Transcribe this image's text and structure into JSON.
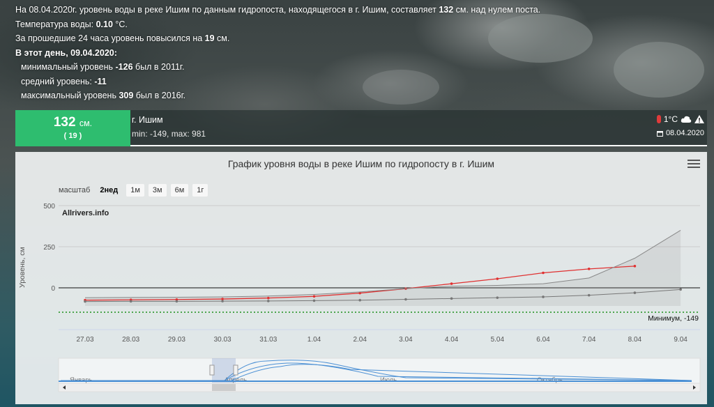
{
  "info": {
    "line1_pre": "На 08.04.2020г. уровень воды в реке Ишим по данным гидропоста, находящегося в г. Ишим, составляет ",
    "line1_value": "132",
    "line1_post": " см. над нулем поста.",
    "temp_pre": "Температура воды: ",
    "temp_value": "0.10",
    "temp_post": " °C.",
    "change_pre": "За прошедшие 24 часа уровень повысился на ",
    "change_value": "19",
    "change_post": " см.",
    "day_heading": "В этот день, 09.04.2020:",
    "min_pre": "минимальный уровень ",
    "min_value": "-126",
    "min_post": " был в 2011г.",
    "avg_pre": "средний уровень: ",
    "avg_value": "-11",
    "max_pre": "максимальный уровень ",
    "max_value": "309",
    "max_post": " был в 2016г."
  },
  "status": {
    "level": "132",
    "unit": "см.",
    "delta": "( 19 )",
    "station": "г. Ишим",
    "minmax": "min: -149, max: 981",
    "temperature": "1°C",
    "date": "08.04.2020",
    "accent": "#2ebd6f"
  },
  "chart": {
    "title": "График уровня воды в реке Ишим по гидропосту в г. Ишим",
    "zoom_label": "масштаб",
    "zoom_buttons": [
      "2нед",
      "1м",
      "3м",
      "6м",
      "1г"
    ],
    "zoom_active": "2нед",
    "credits": "Allrivers.info",
    "ylabel": "Уровень, см",
    "min_label": "Минимум, -149",
    "navigator_labels": [
      "Январь",
      "Апрель",
      "Июль",
      "Октябрь"
    ]
  },
  "chart_data": {
    "type": "line",
    "categories": [
      "27.03",
      "28.03",
      "29.03",
      "30.03",
      "31.03",
      "1.04",
      "2.04",
      "3.04",
      "4.04",
      "5.04",
      "6.04",
      "7.04",
      "8.04",
      "9.04"
    ],
    "ylim": [
      -149,
      500
    ],
    "yticks": [
      0,
      250,
      500
    ],
    "ylabel": "Уровень, см",
    "series": [
      {
        "name": "",
        "color": "#e03030",
        "values": [
          -75,
          -73,
          -71,
          -68,
          -62,
          -52,
          -32,
          -5,
          25,
          55,
          91,
          115,
          132,
          null
        ]
      },
      {
        "name": "",
        "color": "#777777",
        "values": [
          -83,
          -82,
          -82,
          -81,
          -80,
          -78,
          -75,
          -70,
          -65,
          -60,
          -55,
          -45,
          -30,
          -10
        ]
      },
      {
        "name": "",
        "color": "#888888",
        "values": [
          -60,
          -58,
          -57,
          -55,
          -50,
          -40,
          -25,
          -5,
          10,
          15,
          25,
          60,
          180,
          350
        ]
      },
      {
        "name": "",
        "color": "#000000",
        "values": [
          0,
          0,
          0,
          0,
          0,
          0,
          0,
          0,
          0,
          0,
          0,
          0,
          0,
          0
        ]
      }
    ],
    "min_line": -149
  }
}
